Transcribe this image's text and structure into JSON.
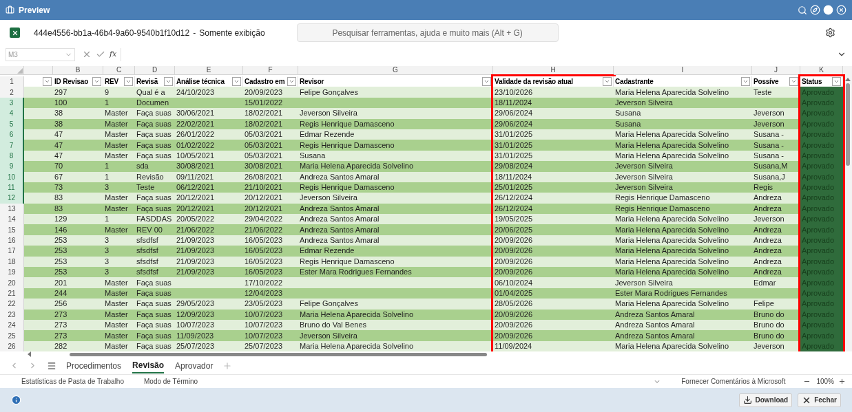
{
  "window": {
    "title": "Preview"
  },
  "document": {
    "name": "444e4556-bb1a-46b4-9a60-9540b1f10d12",
    "separator": "-",
    "mode": "Somente exibição"
  },
  "formula_bar": {
    "function_label": "fx"
  },
  "search": {
    "placeholder": "Pesquisar ferramentas, ajuda e muito mais (Alt + G)"
  },
  "name_box": {
    "value": "M3"
  },
  "sheet": {
    "header_row": "1",
    "columns": [
      {
        "letter": "B",
        "header": "ID Revisao",
        "kind": "text",
        "outlined": false
      },
      {
        "letter": "C",
        "header": "REV",
        "kind": "text",
        "outlined": false
      },
      {
        "letter": "D",
        "header": "Revisã",
        "kind": "text",
        "outlined": false
      },
      {
        "letter": "E",
        "header": "Análise técnica",
        "kind": "text",
        "outlined": false
      },
      {
        "letter": "F",
        "header": "Cadastro em",
        "kind": "text",
        "outlined": false
      },
      {
        "letter": "G",
        "header": "Revisor",
        "kind": "text",
        "outlined": false
      },
      {
        "letter": "H",
        "header": "Validade da revisão atual",
        "kind": "text",
        "outlined": true
      },
      {
        "letter": "I",
        "header": "Cadastrante",
        "kind": "text",
        "outlined": false
      },
      {
        "letter": "J",
        "header": "Possíve",
        "kind": "text",
        "outlined": false
      },
      {
        "letter": "K",
        "header": "Status",
        "kind": "status",
        "outlined": true
      }
    ],
    "rows": [
      {
        "number": "2",
        "selected": false,
        "cells": [
          "297",
          "9",
          "Qual é a",
          "24/10/2023",
          "20/09/2023",
          "Felipe Gonçalves",
          "23/10/2026",
          "Maria Helena Aparecida Solvelino",
          "Teste",
          "Aprovado"
        ]
      },
      {
        "number": "3",
        "selected": true,
        "cells": [
          "100",
          "1",
          "Documen",
          null,
          "15/01/2022",
          null,
          "18/11/2024",
          "Jeverson Silveira",
          null,
          "Aprovado"
        ]
      },
      {
        "number": "4",
        "selected": true,
        "cells": [
          "38",
          "Master",
          "Faça suas",
          "30/06/2021",
          "18/02/2021",
          "Jeverson Silveira",
          "29/06/2024",
          "Susana",
          "Jeverson",
          "Aprovado"
        ]
      },
      {
        "number": "5",
        "selected": true,
        "cells": [
          "38",
          "Master",
          "Faça suas",
          "22/02/2021",
          "18/02/2021",
          "Regis Henrique Damasceno",
          "29/06/2024",
          "Susana",
          "Jeverson",
          "Aprovado"
        ]
      },
      {
        "number": "6",
        "selected": true,
        "cells": [
          "47",
          "Master",
          "Faça suas",
          "26/01/2022",
          "05/03/2021",
          "Edmar Rezende",
          "31/01/2025",
          "Maria Helena Aparecida Solvelino",
          "Susana -",
          "Aprovado"
        ]
      },
      {
        "number": "7",
        "selected": true,
        "cells": [
          "47",
          "Master",
          "Faça suas",
          "01/02/2022",
          "05/03/2021",
          "Regis Henrique Damasceno",
          "31/01/2025",
          "Maria Helena Aparecida Solvelino",
          "Susana -",
          "Aprovado"
        ]
      },
      {
        "number": "8",
        "selected": true,
        "cells": [
          "47",
          "Master",
          "Faça suas",
          "10/05/2021",
          "05/03/2021",
          "Susana",
          "31/01/2025",
          "Maria Helena Aparecida Solvelino",
          "Susana -",
          "Aprovado"
        ]
      },
      {
        "number": "9",
        "selected": true,
        "cells": [
          "70",
          "1",
          "sda",
          "30/08/2021",
          "30/08/2021",
          "Maria Helena Aparecida Solvelino",
          "29/08/2024",
          "Jeverson Silveira",
          "Susana,M",
          "Aprovado"
        ]
      },
      {
        "number": "10",
        "selected": true,
        "cells": [
          "67",
          "1",
          "Revisão",
          "09/11/2021",
          "26/08/2021",
          "Andreza Santos Amaral",
          "18/11/2024",
          "Jeverson Silveira",
          "Susana,J",
          "Aprovado"
        ]
      },
      {
        "number": "11",
        "selected": true,
        "cells": [
          "73",
          "3",
          "Teste",
          "06/12/2021",
          "21/10/2021",
          "Regis Henrique Damasceno",
          "25/01/2025",
          "Jeverson Silveira",
          "Regis",
          "Aprovado"
        ]
      },
      {
        "number": "12",
        "selected": true,
        "cells": [
          "83",
          "Master",
          "Faça suas",
          "20/12/2021",
          "20/12/2021",
          "Jeverson Silveira",
          "26/12/2024",
          "Regis Henrique Damasceno",
          "Andreza",
          "Aprovado"
        ]
      },
      {
        "number": "13",
        "selected": false,
        "cells": [
          "83",
          "Master",
          "Faça suas",
          "20/12/2021",
          "20/12/2021",
          "Andreza Santos Amaral",
          "26/12/2024",
          "Regis Henrique Damasceno",
          "Andreza",
          "Aprovado"
        ]
      },
      {
        "number": "14",
        "selected": false,
        "cells": [
          "129",
          "1",
          "FASDDAS",
          "20/05/2022",
          "29/04/2022",
          "Andreza Santos Amaral",
          "19/05/2025",
          "Maria Helena Aparecida Solvelino",
          "Jeverson",
          "Aprovado"
        ]
      },
      {
        "number": "15",
        "selected": false,
        "cells": [
          "146",
          "Master",
          "REV 00",
          "21/06/2022",
          "21/06/2022",
          "Andreza Santos Amaral",
          "20/06/2025",
          "Maria Helena Aparecida Solvelino",
          "Andreza",
          "Aprovado"
        ]
      },
      {
        "number": "16",
        "selected": false,
        "cells": [
          "253",
          "3",
          "sfsdfsf",
          "21/09/2023",
          "16/05/2023",
          "Andreza Santos Amaral",
          "20/09/2026",
          "Maria Helena Aparecida Solvelino",
          "Andreza",
          "Aprovado"
        ]
      },
      {
        "number": "17",
        "selected": false,
        "cells": [
          "253",
          "3",
          "sfsdfsf",
          "21/09/2023",
          "16/05/2023",
          "Edmar Rezende",
          "20/09/2026",
          "Maria Helena Aparecida Solvelino",
          "Andreza",
          "Aprovado"
        ]
      },
      {
        "number": "18",
        "selected": false,
        "cells": [
          "253",
          "3",
          "sfsdfsf",
          "21/09/2023",
          "16/05/2023",
          "Regis Henrique Damasceno",
          "20/09/2026",
          "Maria Helena Aparecida Solvelino",
          "Andreza",
          "Aprovado"
        ]
      },
      {
        "number": "19",
        "selected": false,
        "cells": [
          "253",
          "3",
          "sfsdfsf",
          "21/09/2023",
          "16/05/2023",
          "Ester Mara Rodrigues Fernandes",
          "20/09/2026",
          "Maria Helena Aparecida Solvelino",
          "Andreza",
          "Aprovado"
        ]
      },
      {
        "number": "20",
        "selected": false,
        "cells": [
          "201",
          "Master",
          "Faça suas",
          null,
          "17/10/2022",
          null,
          "06/10/2024",
          "Jeverson Silveira",
          "Edmar",
          "Aprovado"
        ]
      },
      {
        "number": "21",
        "selected": false,
        "cells": [
          "244",
          "Master",
          "Faça suas",
          null,
          "12/04/2023",
          null,
          "01/04/2025",
          "Ester Mara Rodrigues Fernandes",
          null,
          "Aprovado"
        ]
      },
      {
        "number": "22",
        "selected": false,
        "cells": [
          "256",
          "Master",
          "Faça suas",
          "29/05/2023",
          "23/05/2023",
          "Felipe Gonçalves",
          "28/05/2026",
          "Maria Helena Aparecida Solvelino",
          "Felipe",
          "Aprovado"
        ]
      },
      {
        "number": "23",
        "selected": false,
        "cells": [
          "273",
          "Master",
          "Faça suas",
          "12/09/2023",
          "10/07/2023",
          "Maria Helena Aparecida Solvelino",
          "20/09/2026",
          "Andreza Santos Amaral",
          "Bruno do",
          "Aprovado"
        ]
      },
      {
        "number": "24",
        "selected": false,
        "cells": [
          "273",
          "Master",
          "Faça suas",
          "10/07/2023",
          "10/07/2023",
          "Bruno do Val Benes",
          "20/09/2026",
          "Andreza Santos Amaral",
          "Bruno do",
          "Aprovado"
        ]
      },
      {
        "number": "25",
        "selected": false,
        "cells": [
          "273",
          "Master",
          "Faça suas",
          "11/09/2023",
          "10/07/2023",
          "Jeverson Silveira",
          "20/09/2026",
          "Andreza Santos Amaral",
          "Bruno do",
          "Aprovado"
        ]
      },
      {
        "number": "26",
        "selected": false,
        "cells": [
          "282",
          "Master",
          "Faça suas",
          "25/07/2023",
          "25/07/2023",
          "Maria Helena Aparecida Solvelino",
          "11/09/2024",
          "Maria Helena Aparecida Solvelino",
          "Jeverson",
          "Aprovado"
        ]
      }
    ]
  },
  "sheet_tabs": [
    {
      "label": "Procedimentos",
      "selected": false
    },
    {
      "label": "Revisão",
      "selected": true
    },
    {
      "label": "Aprovador",
      "selected": false
    }
  ],
  "status_bar": {
    "items": [
      "Estatísticas de Pasta de Trabalho",
      "Modo de Término"
    ],
    "feedback": "Fornecer Comentários à Microsoft",
    "zoom": "100%"
  },
  "footer": {
    "buttons": [
      "Download",
      "Fechar"
    ]
  }
}
